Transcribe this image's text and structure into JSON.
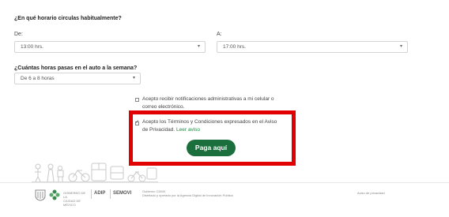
{
  "question_schedule": "¿En qué horario circulas habitualmente?",
  "from_label": "De:",
  "from_value": "13:00 hrs.",
  "to_label": "A:",
  "to_value": "17:00 hrs.",
  "question_hours": "¿Cuántas horas pasas en el auto a la semana?",
  "hours_value": "De 6 a 8 horas",
  "notif_line1": "Acepto recibir notificaciones administrativas a mi celular o",
  "notif_line2": "correo electrónico.",
  "terms_line1": "Acepto los Términos y Condiciones expresados en el Aviso",
  "terms_line2": "de Privacidad.",
  "terms_link": "Leer aviso",
  "pay_button": "Paga aquí",
  "footer": {
    "gob_line1": "GOBIERNO DE LA",
    "gob_line2": "CIUDAD DE MÉXICO",
    "adip": "ADIP",
    "semovi": "SEMOVI",
    "site_name": "Gobierno CDMX",
    "credit": "Diseñado y operado por la Agencia Digital de Innovación Pública",
    "privacy": "Aviso de privacidad"
  },
  "colors": {
    "accent": "#1b6f3c",
    "highlight": "#e00000"
  }
}
